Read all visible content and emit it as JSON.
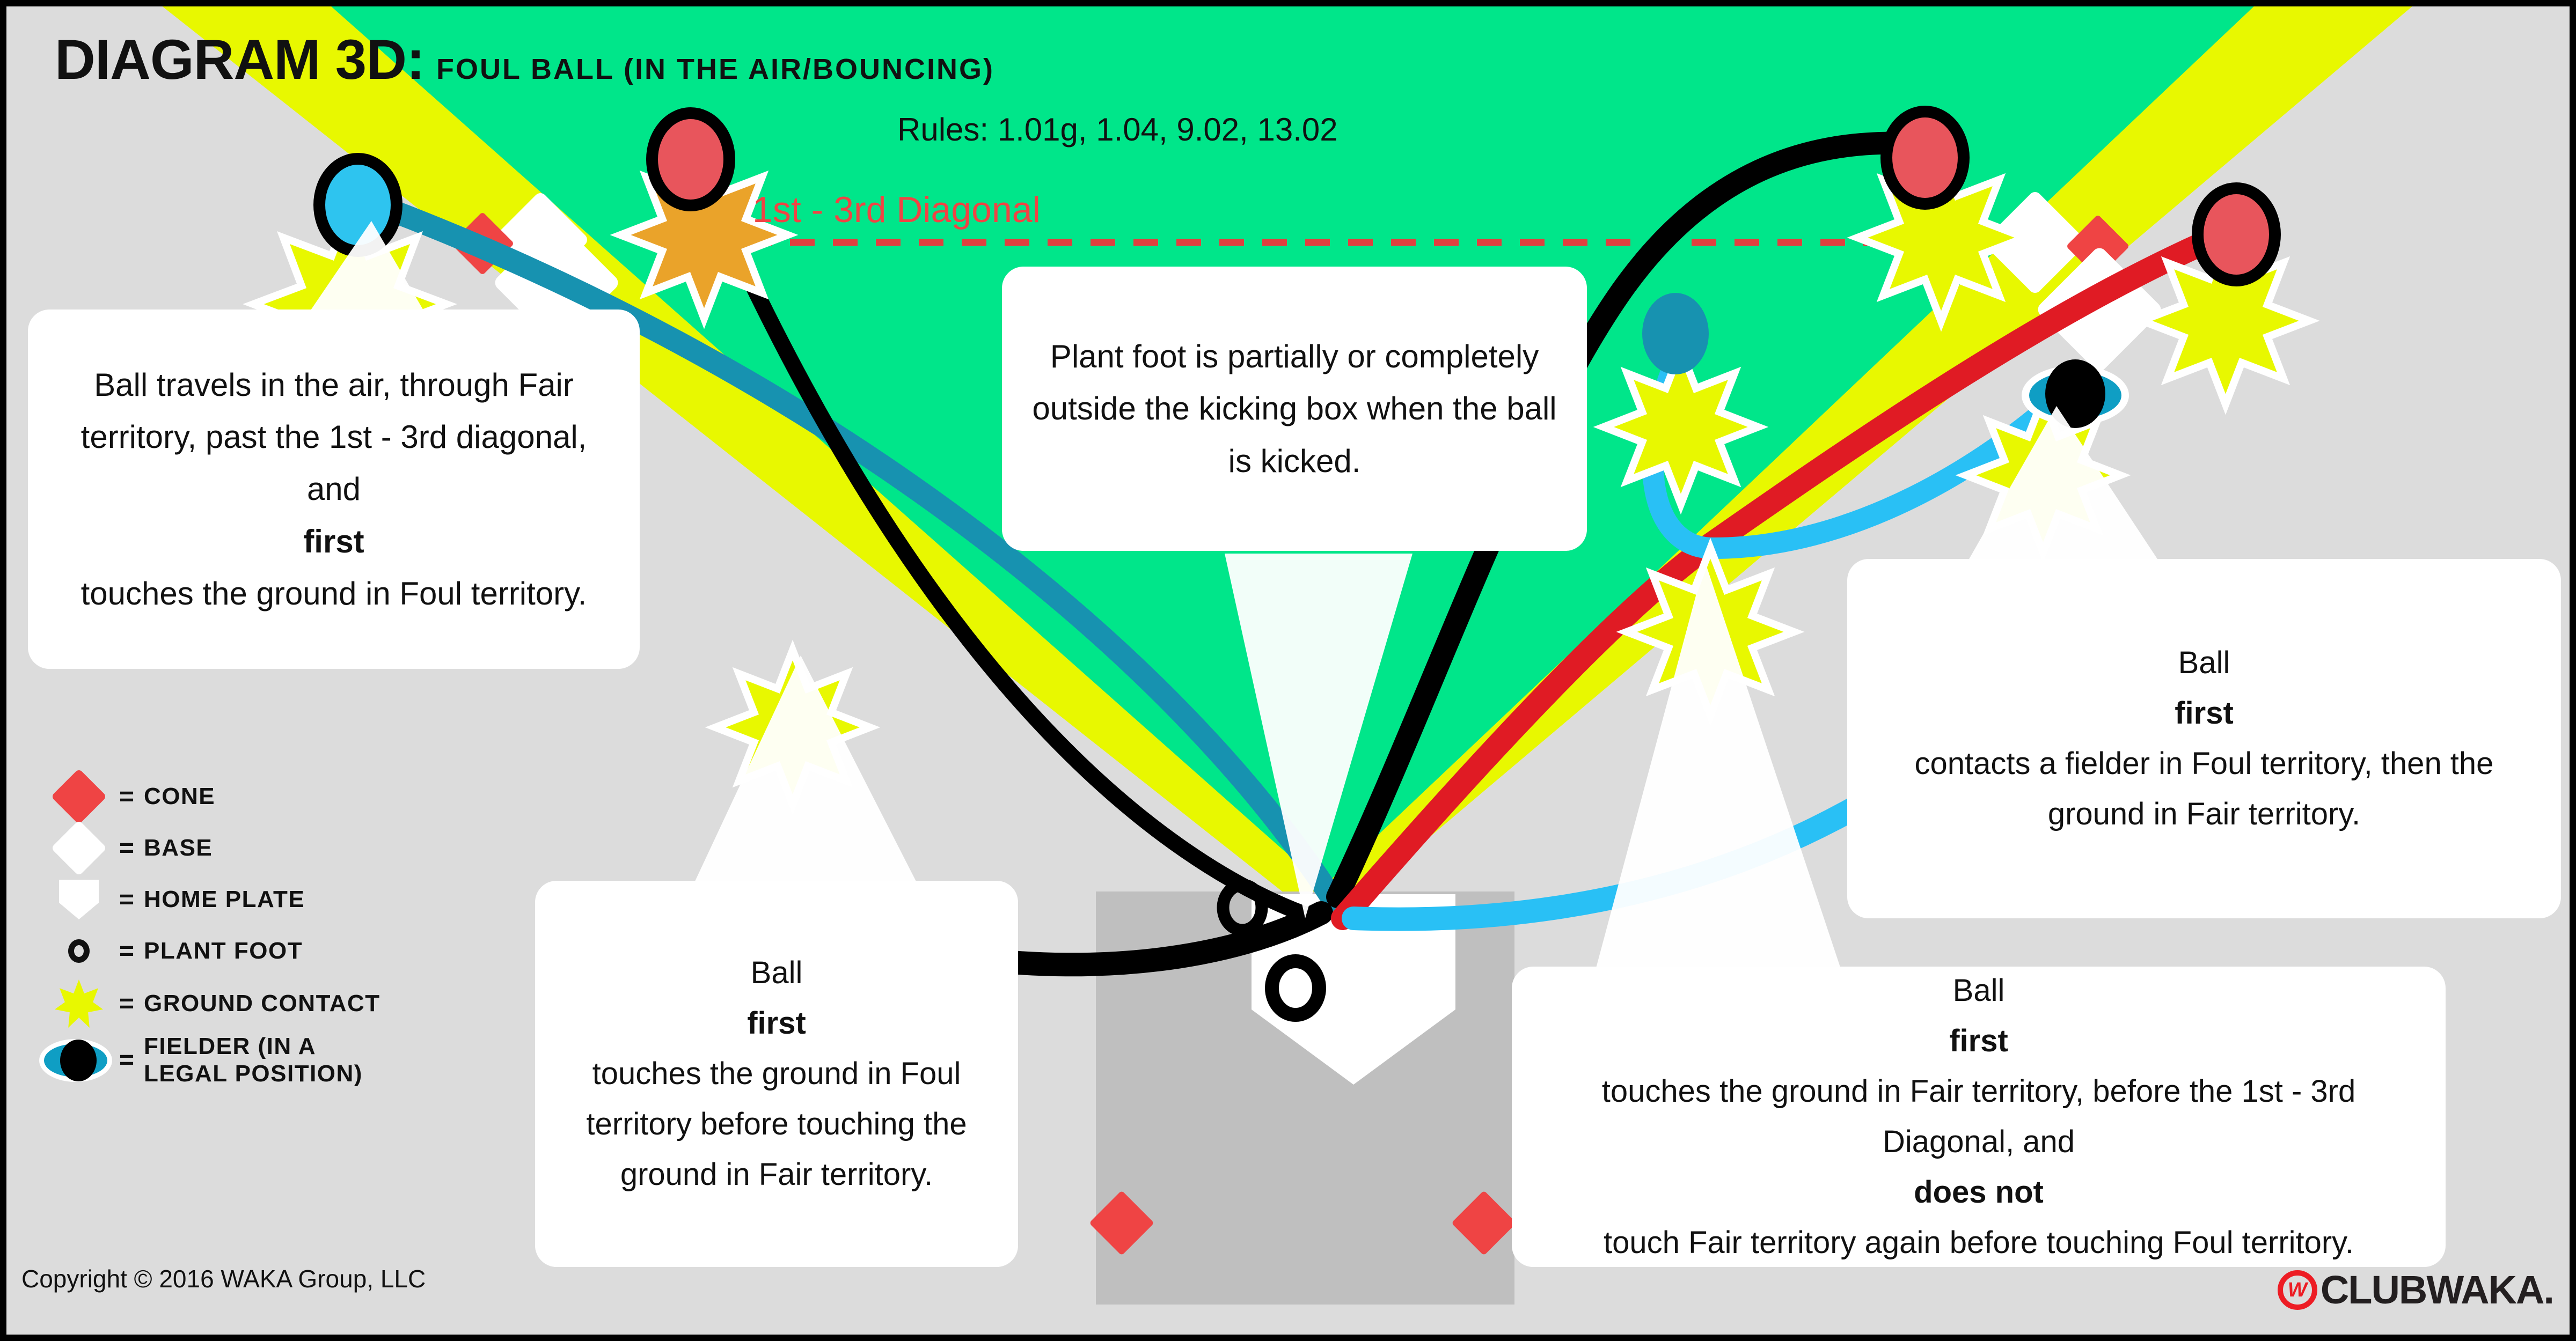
{
  "title": {
    "main": "DIAGRAM 3D:",
    "subtitle": "FOUL BALL (IN THE AIR/BOUNCING)",
    "rules": "Rules: 1.01g, 1.04, 9.02, 13.02"
  },
  "field": {
    "diagonal_label": "1st - 3rd Diagonal",
    "colors": {
      "fair_green": "#00e68a",
      "foul_gray": "#dcdcdc",
      "foul_line_yellow": "#e8f800",
      "kicking_box": "#bfbfbf",
      "cone_red": "#ef4444",
      "base_white": "#ffffff",
      "diagonal_red": "#ef4444",
      "ground_contact_yellow": "#e8f800",
      "ground_contact_orange": "#eaa32a",
      "fielder_teal": "#0f9ec4",
      "ball_red": "#e8555c",
      "ball_blue": "#2ec4ef",
      "path_teal": "#1792b0",
      "path_black": "#000000",
      "path_red": "#e01b24",
      "path_cyan": "#29c0f5"
    }
  },
  "callouts": {
    "left": {
      "before": "Ball travels in the air, through Fair territory, past the 1st - 3rd diagonal, and ",
      "bold": "first",
      "after": " touches the ground in Foul territory."
    },
    "center": {
      "before": "Plant foot is partially or completely outside the kicking box when the ball is kicked.",
      "bold": "",
      "after": ""
    },
    "bottom": {
      "before": "Ball ",
      "bold": "first",
      "after": " touches the ground in Foul territory before touching the ground in Fair territory."
    },
    "right": {
      "before": "Ball ",
      "bold": "first",
      "after": " contacts a fielder in Foul territory, then the ground in Fair territory."
    },
    "bottom_right": {
      "before": "Ball ",
      "bold": "first",
      "mid": " touches the ground in Fair territory, before the 1st - 3rd Diagonal, and ",
      "bold2": "does not",
      "after": " touch Fair territory again before touching Foul territory."
    }
  },
  "legend": {
    "equals": "=",
    "items": [
      {
        "icon": "cone-diamond-icon",
        "label": "CONE"
      },
      {
        "icon": "base-diamond-icon",
        "label": "BASE"
      },
      {
        "icon": "home-plate-icon",
        "label": "HOME PLATE"
      },
      {
        "icon": "plant-foot-icon",
        "label": "PLANT FOOT"
      },
      {
        "icon": "ground-contact-star-icon",
        "label": "GROUND CONTACT"
      },
      {
        "icon": "fielder-icon",
        "label": "FIELDER (IN A\nLEGAL POSITION)"
      }
    ]
  },
  "footer": {
    "copyright": "Copyright © 2016 WAKA Group, LLC",
    "brand_mark": "W",
    "brand_text": "CLUBWAKA."
  }
}
